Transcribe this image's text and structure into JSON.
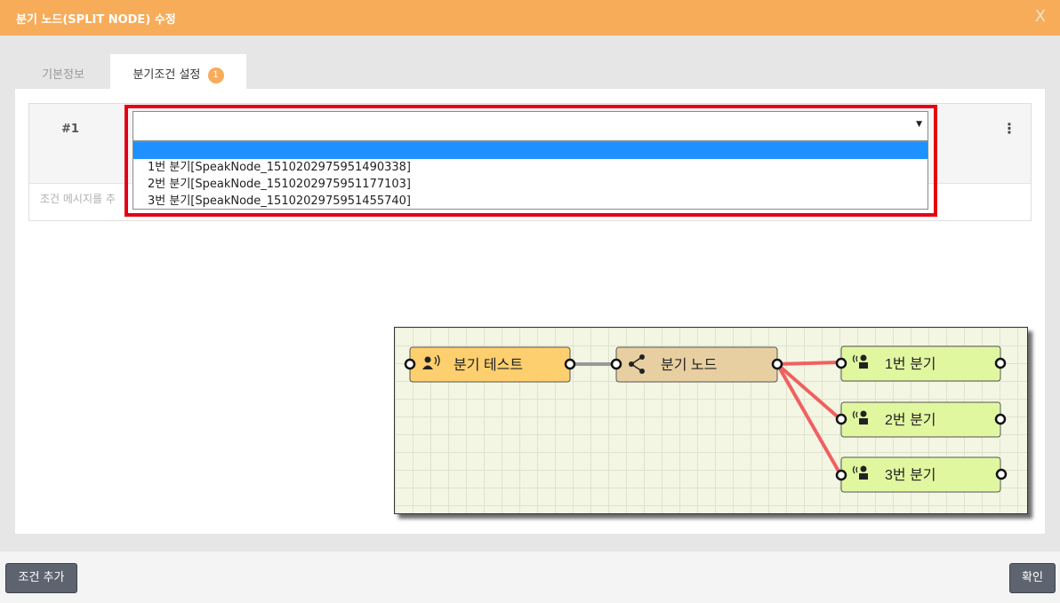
{
  "dialog": {
    "title": "분기 노드(SPLIT NODE) 수정",
    "close": "X"
  },
  "tabs": [
    {
      "label": "기본정보",
      "active": false
    },
    {
      "label": "분기조건 설정",
      "badge": "1",
      "active": true
    }
  ],
  "condition": {
    "number": "#1",
    "menu": "⋮",
    "message_placeholder": "조건 메시지를 추",
    "select": {
      "value": "",
      "options": [
        "",
        "1번 분기[SpeakNode_1510202975951490338]",
        "2번 분기[SpeakNode_1510202975951177103]",
        "3번 분기[SpeakNode_1510202975951455740]"
      ]
    }
  },
  "flow": {
    "nodes": [
      {
        "label": "분기 테스트",
        "icon": "speaker-person-icon",
        "color": "#fdcf6e"
      },
      {
        "label": "분기 노드",
        "icon": "share-icon",
        "color": "#e8cfa2"
      },
      {
        "label": "1번 분기",
        "icon": "speaker-person-icon",
        "color": "#e0f7a0"
      },
      {
        "label": "2번 분기",
        "icon": "speaker-person-icon",
        "color": "#e0f7a0"
      },
      {
        "label": "3번 분기",
        "icon": "speaker-person-icon",
        "color": "#e0f7a0"
      }
    ],
    "link_colors": {
      "normal": "#999999",
      "split": "#f06060"
    }
  },
  "footer": {
    "add_label": "조건 추가",
    "ok_label": "확인"
  },
  "colors": {
    "accent": "#f7ac5a",
    "highlight": "#e60012",
    "selected_option": "#1e90ff",
    "button": "#5d6470"
  }
}
